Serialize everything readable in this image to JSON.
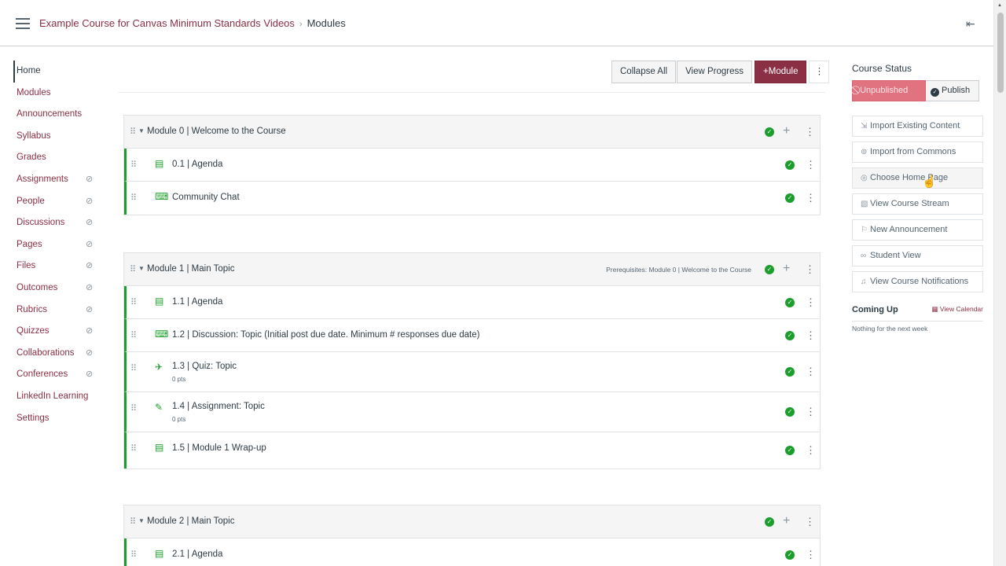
{
  "header": {
    "course_link": "Example Course for Canvas Minimum Standards Videos",
    "separator": "›",
    "current": "Modules"
  },
  "leftnav": [
    {
      "label": "Home",
      "active": true,
      "hidden": false
    },
    {
      "label": "Modules",
      "hidden": false
    },
    {
      "label": "Announcements",
      "hidden": false
    },
    {
      "label": "Syllabus",
      "hidden": false
    },
    {
      "label": "Grades",
      "hidden": false
    },
    {
      "label": "Assignments",
      "hidden": true
    },
    {
      "label": "People",
      "hidden": true
    },
    {
      "label": "Discussions",
      "hidden": true
    },
    {
      "label": "Pages",
      "hidden": true
    },
    {
      "label": "Files",
      "hidden": true
    },
    {
      "label": "Outcomes",
      "hidden": true
    },
    {
      "label": "Rubrics",
      "hidden": true
    },
    {
      "label": "Quizzes",
      "hidden": true
    },
    {
      "label": "Collaborations",
      "hidden": true
    },
    {
      "label": "Conferences",
      "hidden": true
    },
    {
      "label": "LinkedIn Learning",
      "hidden": false
    },
    {
      "label": "Settings",
      "hidden": false
    }
  ],
  "toolbar": {
    "collapse_all": "Collapse All",
    "view_progress": "View Progress",
    "add_module": "Module",
    "add_module_icon": "+"
  },
  "modules": [
    {
      "title": "Module 0 | Welcome to the Course",
      "prerequisites": "",
      "items": [
        {
          "icon": "page-icon",
          "title": "0.1 | Agenda",
          "points": ""
        },
        {
          "icon": "discussion-icon",
          "title": "Community Chat",
          "points": ""
        }
      ]
    },
    {
      "title": "Module 1 | Main Topic",
      "prerequisites": "Prerequisites: Module 0 | Welcome to the Course",
      "items": [
        {
          "icon": "page-icon",
          "title": "1.1 | Agenda",
          "points": ""
        },
        {
          "icon": "discussion-icon",
          "title": "1.2 | Discussion: Topic (Initial post due date. Minimum # responses due date)",
          "points": ""
        },
        {
          "icon": "quiz-icon",
          "title": "1.3 | Quiz: Topic",
          "points": "0 pts"
        },
        {
          "icon": "assignment-icon",
          "title": "1.4 | Assignment: Topic",
          "points": "0 pts"
        },
        {
          "icon": "page-icon",
          "title": "1.5 | Module 1 Wrap-up",
          "points": ""
        }
      ]
    },
    {
      "title": "Module 2 | Main Topic",
      "prerequisites": "",
      "items": [
        {
          "icon": "page-icon",
          "title": "2.1 | Agenda",
          "points": ""
        }
      ]
    }
  ],
  "sidebar": {
    "course_status": "Course Status",
    "unpublished": "Unpublished",
    "publish": "Publish",
    "actions": [
      {
        "icon": "import-icon",
        "label": "Import Existing Content"
      },
      {
        "icon": "commons-icon",
        "label": "Import from Commons"
      },
      {
        "icon": "home-page-icon",
        "label": "Choose Home Page"
      },
      {
        "icon": "stream-icon",
        "label": "View Course Stream"
      },
      {
        "icon": "announcement-icon",
        "label": "New Announcement"
      },
      {
        "icon": "student-view-icon",
        "label": "Student View"
      },
      {
        "icon": "bell-icon",
        "label": "View Course Notifications"
      }
    ],
    "coming_up": "Coming Up",
    "view_calendar": "View Calendar",
    "nothing": "Nothing for the next week"
  },
  "colors": {
    "brand": "#8b2f45",
    "published_green": "#1b9e2b",
    "unpublished_red": "#e0737f"
  }
}
